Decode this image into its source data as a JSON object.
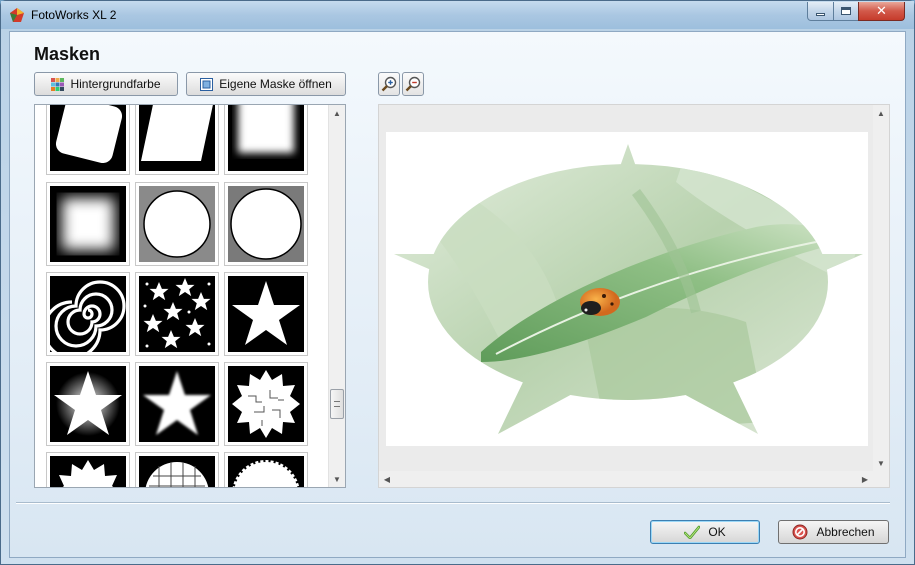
{
  "window": {
    "title": "FotoWorks XL 2",
    "app_icon": "fotoworks-logo-icon"
  },
  "header": {
    "title": "Masken"
  },
  "toolbar": {
    "background_color_label": "Hintergrundfarbe",
    "background_color_icon": "color-grid-icon",
    "open_mask_label": "Eigene Maske öffnen",
    "open_mask_icon": "mask-frame-icon",
    "zoom_in_icon": "zoom-in-icon",
    "zoom_out_icon": "zoom-out-icon"
  },
  "mask_list": {
    "items": [
      "rotated-rounded-square",
      "parallelogram",
      "soft-square",
      "blurred-square",
      "circle-on-gray",
      "circle-on-dark-gray",
      "spiral",
      "scattered-stars",
      "star",
      "star-glow",
      "soft-star",
      "puzzle-burst",
      "jagged-burst",
      "mosaic-burst",
      "jagged-circle"
    ]
  },
  "preview": {
    "subject": "ladybug on green leaf with star and ellipse mask"
  },
  "footer": {
    "ok_label": "OK",
    "ok_icon": "checkmark-icon",
    "cancel_label": "Abbrechen",
    "cancel_icon": "cancel-icon"
  },
  "colors": {
    "accent": "#3c7fb1",
    "leaf_green": "#6fa86a"
  }
}
